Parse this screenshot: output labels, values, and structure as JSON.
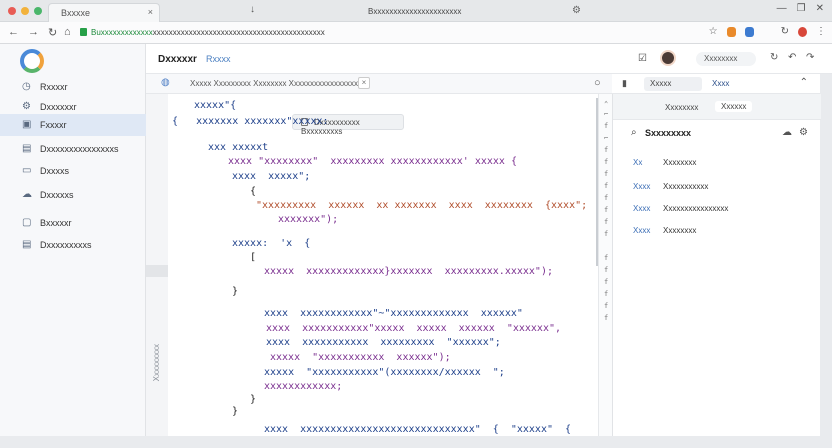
{
  "browser": {
    "tab_title": "Bxxxxe",
    "tab_close": "×",
    "center_title": "Bxxxxxxxxxxxxxxxxxxxxxx",
    "url_domain": "Buxxxxxxxxxxxxx",
    "url_path": "xxxxxxxxxxxxxxxxxxxxxxxxxxxxxxxxxxxxxxxxxxx",
    "dots": [
      "#e85c55",
      "#f2b23b",
      "#4ab66a"
    ]
  },
  "sidebar": {
    "items": [
      {
        "label": "Rxxxxr"
      },
      {
        "label": "Dxxxxxxr"
      },
      {
        "label": "Fxxxxr"
      },
      {
        "label": "Dxxxxxxxxxxxxxxxs"
      },
      {
        "label": "Dxxxxs"
      },
      {
        "label": "Dxxxxxs"
      },
      {
        "label": "Bxxxxxr"
      },
      {
        "label": "Dxxxxxxxxxs"
      }
    ]
  },
  "main": {
    "title": "Dxxxxxr",
    "subtitle": "Rxxxx",
    "toolbar_text": "Xxxxx Xxxxxxxxx  Xxxxxxxx Xxxxxxxxxxxxxxxxx",
    "tooltip_text": "Dxxxxxxxxxx Bxxxxxxxxs"
  },
  "code": {
    "lines": [
      {
        "t": "xxxxx\"{"
      },
      {
        "t": "{   xxxxxxx xxxxxxx\"xxxxx:"
      },
      {
        "t": "xxx xxxxxt"
      },
      {
        "t": "xxxx \"xxxxxxxx\"  xxxxxxxxx xxxxxxxxxxxx' xxxxx {"
      },
      {
        "t": "xxxx  xxxxx\";"
      },
      {
        "t": "{"
      },
      {
        "t": "\"xxxxxxxxx  xxxxxx  xx xxxxxxx  xxxx  xxxxxxxx  {xxxx\";"
      },
      {
        "t": "xxxxxxx\");"
      },
      {
        "t": "xxxxx:  'x  {"
      },
      {
        "t": "["
      },
      {
        "t": "xxxxx  xxxxxxxxxxxxx}xxxxxxx  xxxxxxxxx.xxxxx\");"
      },
      {
        "t": "}"
      },
      {
        "t": "xxxx  xxxxxxxxxxxx\"~\"xxxxxxxxxxxxx  xxxxxx\""
      },
      {
        "t": "xxxx  xxxxxxxxxxx\"xxxxx  xxxxx  xxxxxx  \"xxxxxx\","
      },
      {
        "t": "xxxx  xxxxxxxxxxx  xxxxxxxxx  \"xxxxxx\";"
      },
      {
        "t": "xxxxx  \"xxxxxxxxxxx  xxxxxx\");"
      },
      {
        "t": "xxxxx  \"xxxxxxxxxxx\"(xxxxxxxx/xxxxxx  \";"
      },
      {
        "t": "xxxxxxxxxxxx;"
      },
      {
        "t": "}"
      },
      {
        "t": "}"
      },
      {
        "t": "xxxx  xxxxxxxxxxxxxxxxxxxxxxxxxxxxx\"  {  \"xxxxx\"  {"
      }
    ],
    "gutter_label": "Xxxxxxxxx"
  },
  "strip": {
    "marks": [
      "⌃",
      "⌐",
      "f",
      "⌐",
      "f",
      "f",
      "f",
      "f",
      "f",
      "f",
      "f",
      "f",
      "f",
      "f",
      "f",
      "f",
      "f",
      "f",
      "f",
      "f",
      "f"
    ]
  },
  "top_right": {
    "pill_text": "Xxxxxxxx"
  },
  "right_panel": {
    "tab_a": "Xxxxx",
    "tab_b": "Xxxx",
    "tab_c": "Xxxxxxxx",
    "tab_d": "Xxxxxx",
    "section_title": "Sxxxxxxxx",
    "rows": [
      {
        "k": "Xx",
        "v": "Xxxxxxxx"
      },
      {
        "k": "Xxxx",
        "v": "Xxxxxxxxxxx"
      },
      {
        "k": "Xxxx",
        "v": "Xxxxxxxxxxxxxxxx"
      },
      {
        "k": "Xxxx",
        "v": "Xxxxxxxx"
      }
    ]
  }
}
